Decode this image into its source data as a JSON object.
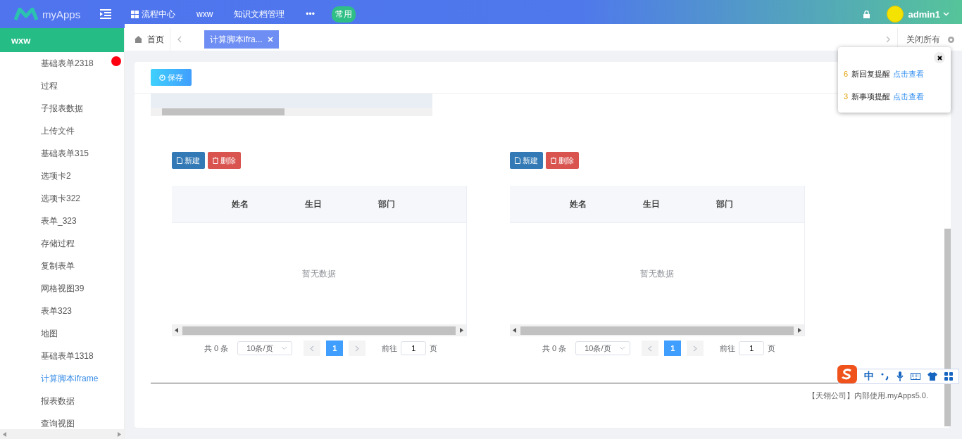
{
  "topbar": {
    "logo": "myApps",
    "nav": [
      {
        "label": "流程中心",
        "kind": "grid"
      },
      {
        "label": "wxw",
        "kind": "text"
      },
      {
        "label": "知识文档管理",
        "kind": "text"
      },
      {
        "label": "•••",
        "kind": "text"
      }
    ],
    "badge": "常用",
    "user": "admin1"
  },
  "tabbar": {
    "home": "首页",
    "tabs": [
      {
        "label": "计算脚本ifra...",
        "selected": true
      }
    ],
    "close_all": "关闭所有"
  },
  "sidebar": {
    "header": "wxw",
    "items": [
      {
        "label": "基础表单2318",
        "alert": true,
        "selected": false
      },
      {
        "label": "过程",
        "alert": false,
        "selected": false
      },
      {
        "label": "子报表数据",
        "alert": false,
        "selected": false
      },
      {
        "label": "上传文件",
        "alert": false,
        "selected": false
      },
      {
        "label": "基础表单315",
        "alert": false,
        "selected": false
      },
      {
        "label": "选项卡2",
        "alert": false,
        "selected": false
      },
      {
        "label": "选项卡322",
        "alert": false,
        "selected": false
      },
      {
        "label": "表单_323",
        "alert": false,
        "selected": false
      },
      {
        "label": "存储过程",
        "alert": false,
        "selected": false
      },
      {
        "label": "复制表单",
        "alert": false,
        "selected": false
      },
      {
        "label": "网格视图39",
        "alert": false,
        "selected": false
      },
      {
        "label": "表单323",
        "alert": false,
        "selected": false
      },
      {
        "label": "地图",
        "alert": false,
        "selected": false
      },
      {
        "label": "基础表单1318",
        "alert": false,
        "selected": false
      },
      {
        "label": "计算脚本iframe",
        "alert": false,
        "selected": true
      },
      {
        "label": "报表数据",
        "alert": false,
        "selected": false
      },
      {
        "label": "查询视图",
        "alert": false,
        "selected": false
      }
    ]
  },
  "content": {
    "save_button": "保存",
    "panels": [
      {
        "new_button": "新建",
        "delete_button": "删除",
        "columns": [
          "姓名",
          "生日",
          "部门"
        ],
        "empty_text": "暂无数据",
        "pagination": {
          "total": "共 0 条",
          "page_size": "10条/页",
          "page": "1",
          "goto_label": "前往",
          "goto_value": "1",
          "page_suffix": "页"
        }
      },
      {
        "new_button": "新建",
        "delete_button": "删除",
        "columns": [
          "姓名",
          "生日",
          "部门"
        ],
        "empty_text": "暂无数据",
        "pagination": {
          "total": "共 0 条",
          "page_size": "10条/页",
          "page": "1",
          "goto_label": "前往",
          "goto_value": "1",
          "page_suffix": "页"
        }
      }
    ],
    "footer": "【天翎公司】内部使用.myApps5.0."
  },
  "notification": {
    "items": [
      {
        "count": "6",
        "text": "新回复提醒",
        "link": "点击查看"
      },
      {
        "count": "3",
        "text": "新事项提醒",
        "link": "点击查看"
      }
    ]
  },
  "ime": {
    "label": "中"
  }
}
